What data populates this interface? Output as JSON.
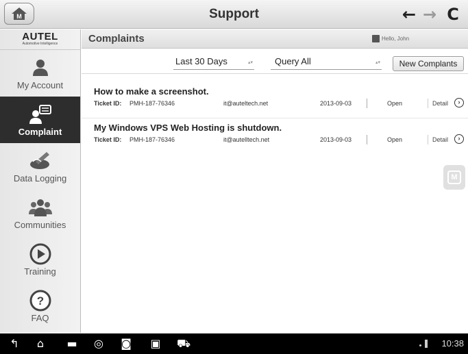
{
  "app": {
    "title": "Support"
  },
  "logo": {
    "main": "AUTEL",
    "sub": "Automotive Intelligence"
  },
  "sidebar": {
    "items": [
      {
        "label": "My Account",
        "icon": "person-icon",
        "active": false
      },
      {
        "label": "Complaint",
        "icon": "complaint-icon",
        "active": true
      },
      {
        "label": "Data Logging",
        "icon": "data-logging-icon",
        "active": false
      },
      {
        "label": "Communities",
        "icon": "communities-icon",
        "active": false
      },
      {
        "label": "Training",
        "icon": "play-icon",
        "active": false
      },
      {
        "label": "FAQ",
        "icon": "question-icon",
        "active": false
      }
    ]
  },
  "main": {
    "title": "Complaints",
    "greeting": "Hello, John",
    "filters": {
      "date_range": "Last 30 Days",
      "query": "Query All",
      "new_button": "New Complants"
    },
    "complaints": [
      {
        "subject": "How to make a screenshot.",
        "ticket_label": "Ticket ID:",
        "ticket_id": "PMH-187-76346",
        "email": "it@auteltech.net",
        "date": "2013-09-03",
        "status": "Open",
        "detail": "Detail"
      },
      {
        "subject": "My Windows VPS Web Hosting is shutdown.",
        "ticket_label": "Ticket ID:",
        "ticket_id": "PMH-187-76346",
        "email": "it@autelltech.net",
        "date": "2013-09-03",
        "status": "Open",
        "detail": "Detail"
      }
    ]
  },
  "floating": {
    "label": "M"
  },
  "system_bar": {
    "time": "10:38"
  }
}
